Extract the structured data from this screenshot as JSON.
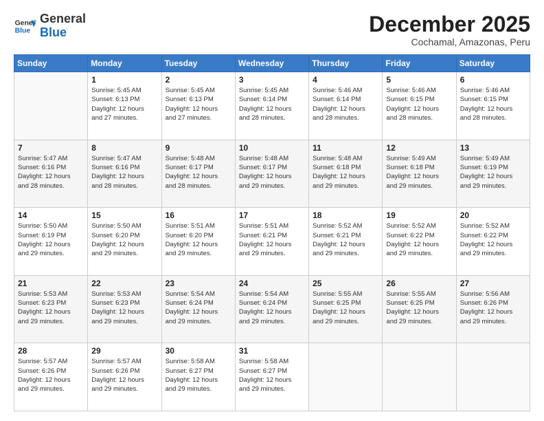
{
  "header": {
    "logo_general": "General",
    "logo_blue": "Blue",
    "month_title": "December 2025",
    "location": "Cochamal, Amazonas, Peru"
  },
  "calendar": {
    "days_of_week": [
      "Sunday",
      "Monday",
      "Tuesday",
      "Wednesday",
      "Thursday",
      "Friday",
      "Saturday"
    ],
    "weeks": [
      [
        {
          "day": "",
          "info": ""
        },
        {
          "day": "1",
          "info": "Sunrise: 5:45 AM\nSunset: 6:13 PM\nDaylight: 12 hours\nand 27 minutes."
        },
        {
          "day": "2",
          "info": "Sunrise: 5:45 AM\nSunset: 6:13 PM\nDaylight: 12 hours\nand 27 minutes."
        },
        {
          "day": "3",
          "info": "Sunrise: 5:45 AM\nSunset: 6:14 PM\nDaylight: 12 hours\nand 28 minutes."
        },
        {
          "day": "4",
          "info": "Sunrise: 5:46 AM\nSunset: 6:14 PM\nDaylight: 12 hours\nand 28 minutes."
        },
        {
          "day": "5",
          "info": "Sunrise: 5:46 AM\nSunset: 6:15 PM\nDaylight: 12 hours\nand 28 minutes."
        },
        {
          "day": "6",
          "info": "Sunrise: 5:46 AM\nSunset: 6:15 PM\nDaylight: 12 hours\nand 28 minutes."
        }
      ],
      [
        {
          "day": "7",
          "info": "Sunrise: 5:47 AM\nSunset: 6:16 PM\nDaylight: 12 hours\nand 28 minutes."
        },
        {
          "day": "8",
          "info": "Sunrise: 5:47 AM\nSunset: 6:16 PM\nDaylight: 12 hours\nand 28 minutes."
        },
        {
          "day": "9",
          "info": "Sunrise: 5:48 AM\nSunset: 6:17 PM\nDaylight: 12 hours\nand 28 minutes."
        },
        {
          "day": "10",
          "info": "Sunrise: 5:48 AM\nSunset: 6:17 PM\nDaylight: 12 hours\nand 29 minutes."
        },
        {
          "day": "11",
          "info": "Sunrise: 5:48 AM\nSunset: 6:18 PM\nDaylight: 12 hours\nand 29 minutes."
        },
        {
          "day": "12",
          "info": "Sunrise: 5:49 AM\nSunset: 6:18 PM\nDaylight: 12 hours\nand 29 minutes."
        },
        {
          "day": "13",
          "info": "Sunrise: 5:49 AM\nSunset: 6:19 PM\nDaylight: 12 hours\nand 29 minutes."
        }
      ],
      [
        {
          "day": "14",
          "info": "Sunrise: 5:50 AM\nSunset: 6:19 PM\nDaylight: 12 hours\nand 29 minutes."
        },
        {
          "day": "15",
          "info": "Sunrise: 5:50 AM\nSunset: 6:20 PM\nDaylight: 12 hours\nand 29 minutes."
        },
        {
          "day": "16",
          "info": "Sunrise: 5:51 AM\nSunset: 6:20 PM\nDaylight: 12 hours\nand 29 minutes."
        },
        {
          "day": "17",
          "info": "Sunrise: 5:51 AM\nSunset: 6:21 PM\nDaylight: 12 hours\nand 29 minutes."
        },
        {
          "day": "18",
          "info": "Sunrise: 5:52 AM\nSunset: 6:21 PM\nDaylight: 12 hours\nand 29 minutes."
        },
        {
          "day": "19",
          "info": "Sunrise: 5:52 AM\nSunset: 6:22 PM\nDaylight: 12 hours\nand 29 minutes."
        },
        {
          "day": "20",
          "info": "Sunrise: 5:52 AM\nSunset: 6:22 PM\nDaylight: 12 hours\nand 29 minutes."
        }
      ],
      [
        {
          "day": "21",
          "info": "Sunrise: 5:53 AM\nSunset: 6:23 PM\nDaylight: 12 hours\nand 29 minutes."
        },
        {
          "day": "22",
          "info": "Sunrise: 5:53 AM\nSunset: 6:23 PM\nDaylight: 12 hours\nand 29 minutes."
        },
        {
          "day": "23",
          "info": "Sunrise: 5:54 AM\nSunset: 6:24 PM\nDaylight: 12 hours\nand 29 minutes."
        },
        {
          "day": "24",
          "info": "Sunrise: 5:54 AM\nSunset: 6:24 PM\nDaylight: 12 hours\nand 29 minutes."
        },
        {
          "day": "25",
          "info": "Sunrise: 5:55 AM\nSunset: 6:25 PM\nDaylight: 12 hours\nand 29 minutes."
        },
        {
          "day": "26",
          "info": "Sunrise: 5:55 AM\nSunset: 6:25 PM\nDaylight: 12 hours\nand 29 minutes."
        },
        {
          "day": "27",
          "info": "Sunrise: 5:56 AM\nSunset: 6:26 PM\nDaylight: 12 hours\nand 29 minutes."
        }
      ],
      [
        {
          "day": "28",
          "info": "Sunrise: 5:57 AM\nSunset: 6:26 PM\nDaylight: 12 hours\nand 29 minutes."
        },
        {
          "day": "29",
          "info": "Sunrise: 5:57 AM\nSunset: 6:26 PM\nDaylight: 12 hours\nand 29 minutes."
        },
        {
          "day": "30",
          "info": "Sunrise: 5:58 AM\nSunset: 6:27 PM\nDaylight: 12 hours\nand 29 minutes."
        },
        {
          "day": "31",
          "info": "Sunrise: 5:58 AM\nSunset: 6:27 PM\nDaylight: 12 hours\nand 29 minutes."
        },
        {
          "day": "",
          "info": ""
        },
        {
          "day": "",
          "info": ""
        },
        {
          "day": "",
          "info": ""
        }
      ]
    ]
  }
}
